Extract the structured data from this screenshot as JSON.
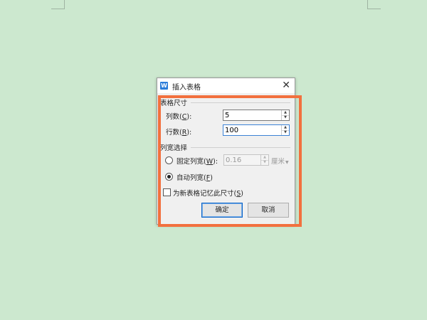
{
  "dialog": {
    "title": "插入表格",
    "app_icon_letter": "W",
    "close_glyph": "✕"
  },
  "table_size": {
    "section_label": "表格尺寸",
    "columns": {
      "label_prefix": "列数(",
      "hotkey": "C",
      "label_suffix": "):",
      "value": "5"
    },
    "rows": {
      "label_prefix": "行数(",
      "hotkey": "R",
      "label_suffix": "):",
      "value": "100"
    }
  },
  "column_width": {
    "section_label": "列宽选择",
    "fixed": {
      "label_prefix": "固定列宽(",
      "hotkey": "W",
      "label_suffix": "):",
      "value": "0.16",
      "unit": "厘米",
      "checked": false
    },
    "auto": {
      "label_prefix": "自动列宽(",
      "hotkey": "F",
      "label_suffix": ")",
      "checked": true
    }
  },
  "remember": {
    "label_prefix": "为新表格记忆此尺寸(",
    "hotkey": "S",
    "label_suffix": ")",
    "checked": false
  },
  "buttons": {
    "ok": "确定",
    "cancel": "取消"
  },
  "highlight_color": "#f2703e",
  "background_color": "#cce8cf"
}
